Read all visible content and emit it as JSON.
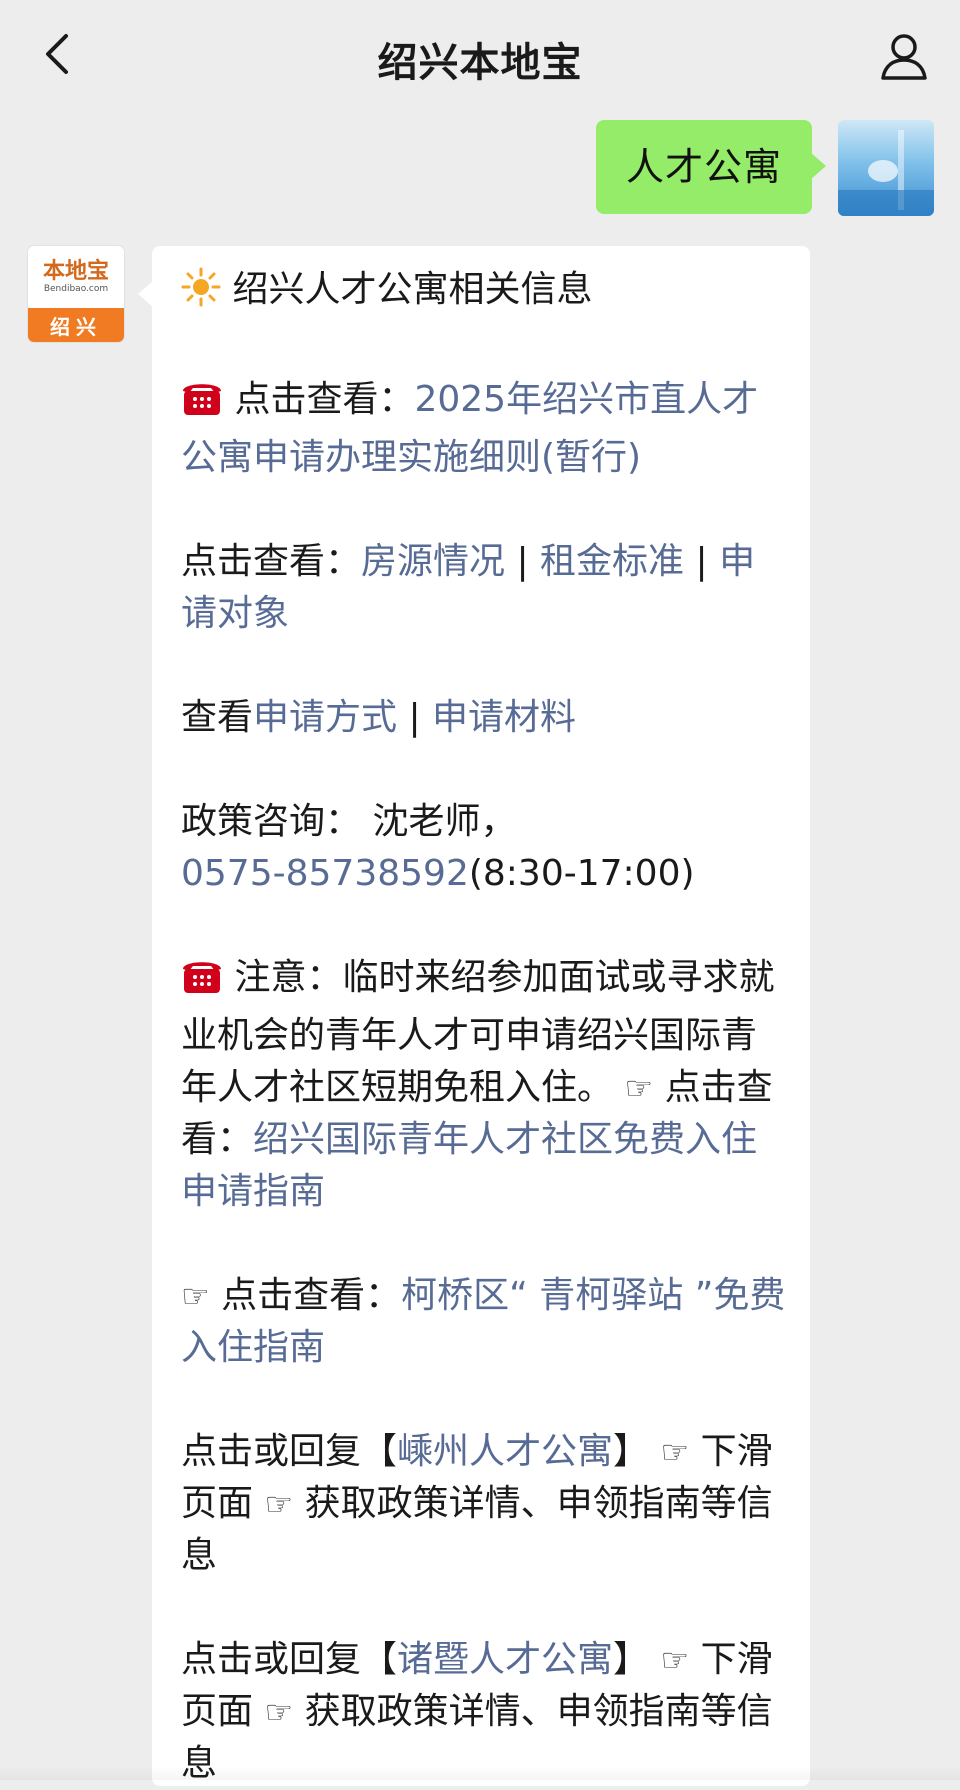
{
  "header": {
    "title": "绍兴本地宝",
    "back_icon": "chevron-left-icon",
    "profile_icon": "person-icon"
  },
  "outgoing": {
    "text": "人才公寓",
    "bubble_color": "#95ec69"
  },
  "bot": {
    "logo_main": "本地宝",
    "logo_sub": "Bendibao.com",
    "logo_city": "绍兴",
    "logo_color": "#f07b22"
  },
  "message": {
    "title_icon": "sun-icon",
    "title": "绍兴人才公寓相关信息",
    "p1": {
      "icon": "telephone-icon",
      "prefix": "点击查看：",
      "link": "2025年绍兴市直人才公寓申请办理实施细则(暂行)"
    },
    "p2": {
      "prefix": "点击查看：",
      "link1": "房源情况",
      "sep1": " | ",
      "link2": "租金标准",
      "sep2": " | ",
      "link3": "申请对象"
    },
    "p3": {
      "prefix": "查看",
      "link1": "申请方式",
      "sep": " | ",
      "link2": "申请材料"
    },
    "p4": {
      "prefix": "政策咨询：  沈老师，",
      "phone": "0575-85738592",
      "hours": "(8:30-17:00)"
    },
    "p5": {
      "icon": "telephone-icon",
      "text": "注意：临时来绍参加面试或寻求就业机会的青年人才可申请绍兴国际青年人才社区短期免租入住。",
      "hand_icon": "pointing-hand-icon",
      "prefix": "点击查看：",
      "link": "绍兴国际青年人才社区免费入住申请指南"
    },
    "p6": {
      "hand_icon": "pointing-hand-icon",
      "prefix": "点击查看：",
      "link": "柯桥区“ 青柯驿站 ”免费入住指南"
    },
    "p7": {
      "prefix": "点击或回复【",
      "link": "嵊州人才公寓",
      "suffix": "】",
      "mid": "下滑页面",
      "tail": "获取政策详情、申领指南等信息"
    },
    "p8": {
      "prefix": "点击或回复【",
      "link": "诸暨人才公寓",
      "suffix": "】",
      "mid": "下滑页面",
      "tail": "获取政策详情、申领指南等信息"
    },
    "link_color": "#576b95"
  }
}
